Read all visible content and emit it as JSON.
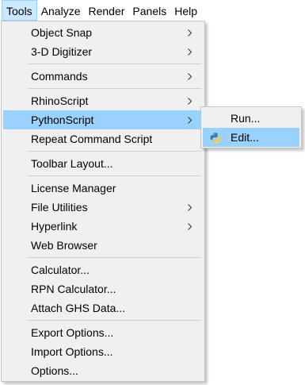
{
  "menubar": {
    "items": [
      {
        "label": "Tools"
      },
      {
        "label": "Analyze"
      },
      {
        "label": "Render"
      },
      {
        "label": "Panels"
      },
      {
        "label": "Help"
      }
    ]
  },
  "tools_menu": {
    "items": [
      {
        "label": "Object Snap",
        "has_submenu": true
      },
      {
        "label": "3-D Digitizer",
        "has_submenu": true
      },
      {
        "label": "Commands",
        "has_submenu": true
      },
      {
        "label": "RhinoScript",
        "has_submenu": true
      },
      {
        "label": "PythonScript",
        "has_submenu": true,
        "selected": true
      },
      {
        "label": "Repeat Command Script"
      },
      {
        "label": "Toolbar Layout..."
      },
      {
        "label": "License Manager"
      },
      {
        "label": "File Utilities",
        "has_submenu": true
      },
      {
        "label": "Hyperlink",
        "has_submenu": true
      },
      {
        "label": "Web Browser"
      },
      {
        "label": "Calculator..."
      },
      {
        "label": "RPN Calculator..."
      },
      {
        "label": "Attach GHS Data..."
      },
      {
        "label": "Export Options..."
      },
      {
        "label": "Import Options..."
      },
      {
        "label": "Options..."
      }
    ]
  },
  "python_submenu": {
    "items": [
      {
        "label": "Run..."
      },
      {
        "label": "Edit...",
        "icon": "python-icon",
        "selected": true
      }
    ]
  },
  "colors": {
    "selection": "#99d1ff",
    "menubar_open": "#cce8ff",
    "menu_background": "#f0f0f0"
  }
}
